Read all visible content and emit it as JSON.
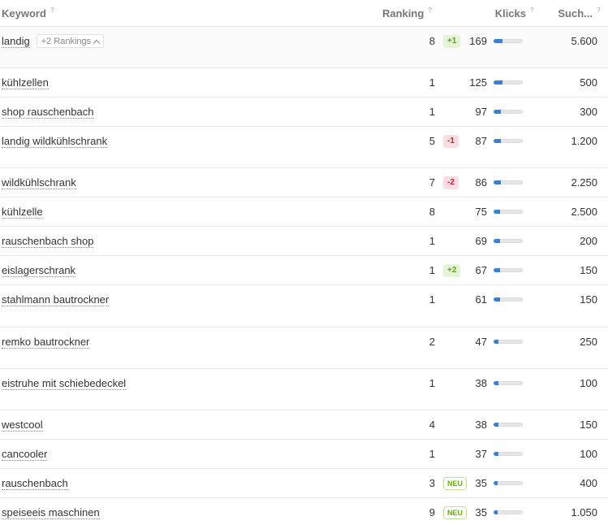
{
  "header": {
    "keyword": "Keyword",
    "ranking": "Ranking",
    "clicks": "Klicks",
    "search": "Such..."
  },
  "colors": {
    "accent_bar": "#3b7fd1",
    "up": "#5a9c1e",
    "down": "#c8202f",
    "neu": "#6aa820"
  },
  "rows": [
    {
      "keyword": "landig",
      "rankings_label": "+2 Rankings",
      "rank": "8",
      "change": "+1",
      "change_type": "up",
      "clicks": "169",
      "clicks_fill": 0.3,
      "search": "5.600",
      "h": 51
    },
    {
      "keyword": "kühlzellen",
      "rank": "1",
      "clicks": "125",
      "clicks_fill": 0.3,
      "search": "500",
      "h": 36
    },
    {
      "keyword": "shop rauschenbach",
      "rank": "1",
      "clicks": "97",
      "clicks_fill": 0.26,
      "search": "300",
      "h": 36
    },
    {
      "keyword": "landig wildkühlschrank",
      "rank": "5",
      "change": "-1",
      "change_type": "down",
      "clicks": "87",
      "clicks_fill": 0.25,
      "search": "1.200",
      "h": 51
    },
    {
      "keyword": "wildkühlschrank",
      "rank": "7",
      "change": "-2",
      "change_type": "down",
      "clicks": "86",
      "clicks_fill": 0.25,
      "search": "2.250",
      "h": 36
    },
    {
      "keyword": "kühlzelle",
      "rank": "8",
      "clicks": "75",
      "clicks_fill": 0.23,
      "search": "2.500",
      "h": 36
    },
    {
      "keyword": "rauschenbach shop",
      "rank": "1",
      "clicks": "69",
      "clicks_fill": 0.22,
      "search": "200",
      "h": 36
    },
    {
      "keyword": "eislagerschrank",
      "rank": "1",
      "change": "+2",
      "change_type": "up",
      "clicks": "67",
      "clicks_fill": 0.22,
      "search": "150",
      "h": 36
    },
    {
      "keyword": "stahlmann bautrockner",
      "rank": "1",
      "clicks": "61",
      "clicks_fill": 0.21,
      "search": "150",
      "h": 52
    },
    {
      "keyword": "remko bautrockner",
      "rank": "2",
      "clicks": "47",
      "clicks_fill": 0.18,
      "search": "250",
      "h": 51
    },
    {
      "keyword": "eistruhe mit schiebedeckel",
      "rank": "1",
      "clicks": "38",
      "clicks_fill": 0.16,
      "search": "100",
      "h": 51
    },
    {
      "keyword": "westcool",
      "rank": "4",
      "clicks": "38",
      "clicks_fill": 0.16,
      "search": "150",
      "h": 36
    },
    {
      "keyword": "cancooler",
      "rank": "1",
      "clicks": "37",
      "clicks_fill": 0.16,
      "search": "100",
      "h": 36
    },
    {
      "keyword": "rauschenbach",
      "rank": "3",
      "change": "NEU",
      "change_type": "neu",
      "clicks": "35",
      "clicks_fill": 0.15,
      "search": "400",
      "h": 36
    },
    {
      "keyword": "speiseeis maschinen",
      "rank": "9",
      "change": "NEU",
      "change_type": "neu",
      "clicks": "35",
      "clicks_fill": 0.15,
      "search": "1.050",
      "h": 36
    }
  ]
}
